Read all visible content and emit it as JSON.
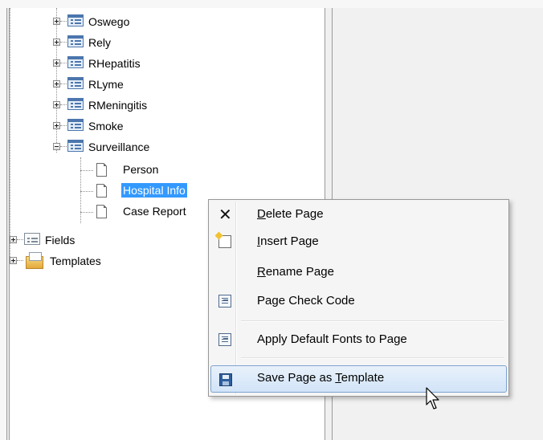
{
  "tree": {
    "items": [
      {
        "label": "Oswego"
      },
      {
        "label": "Rely"
      },
      {
        "label": "RHepatitis"
      },
      {
        "label": "RLyme"
      },
      {
        "label": "RMeningitis"
      },
      {
        "label": "Smoke"
      },
      {
        "label": "Surveillance"
      },
      {
        "label": "Person"
      },
      {
        "label": "Hospital Info"
      },
      {
        "label": "Case Report"
      },
      {
        "label": "Fields"
      },
      {
        "label": "Templates"
      }
    ]
  },
  "context_menu": {
    "items": [
      {
        "label": "Delete Page",
        "mnemonic": "D",
        "rest": "elete Page",
        "icon": "delete-x-icon"
      },
      {
        "label": "Insert Page",
        "mnemonic": "I",
        "rest": "nsert Page",
        "icon": "insert-page-icon"
      },
      {
        "label": "Rename Page",
        "mnemonic": "R",
        "rest": "ename Page",
        "icon": ""
      },
      {
        "label": "Page Check Code",
        "icon": "code-icon"
      },
      {
        "label": "Apply Default Fonts to Page",
        "icon": "code-icon"
      },
      {
        "label": "Save Page as Template",
        "pre": "Save Page as ",
        "mnemonic": "T",
        "rest": "emplate",
        "icon": "save-disk-icon"
      }
    ]
  },
  "colors": {
    "selection": "#3399ff",
    "menu_hover": "#d2e4f8",
    "menu_hover_border": "#7da2ce"
  }
}
